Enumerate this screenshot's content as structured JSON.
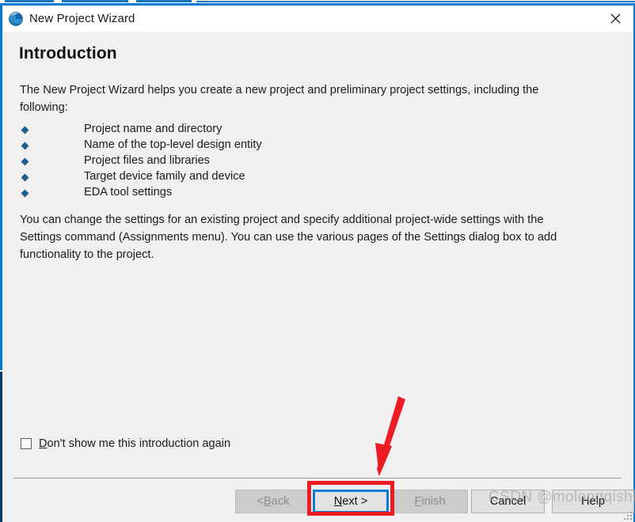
{
  "window": {
    "title": "New Project Wizard",
    "icon": "quartus-globe-icon",
    "close_label": "close-icon",
    "accent_color": "#0078d4",
    "border_lower_color": "#003a66",
    "background_color": "#f0f0f0",
    "titlebar_color": "#ffffff"
  },
  "page": {
    "heading": "Introduction",
    "intro_paragraph": "The New Project Wizard helps you create a new project and preliminary project settings, including the following:",
    "bullets": [
      {
        "label": "Project name and directory"
      },
      {
        "label": "Name of the top-level design entity"
      },
      {
        "label": "Project files and libraries"
      },
      {
        "label": "Target device family and device"
      },
      {
        "label": "EDA tool settings"
      }
    ],
    "bullet_color": "#1f5f8b",
    "closing_paragraph": "You can change the settings for an existing project and specify additional project-wide settings with the Settings command (Assignments menu). You can use the various pages of the Settings dialog box to add functionality to the project."
  },
  "checkbox": {
    "mnemonic": "D",
    "label_rest": "on't show me this introduction again",
    "checked": false
  },
  "buttons": {
    "back": {
      "pre": "< ",
      "mnemonic": "B",
      "post": "ack",
      "enabled": false,
      "focused": false
    },
    "next": {
      "pre": "",
      "mnemonic": "N",
      "post": "ext >",
      "enabled": true,
      "focused": true
    },
    "finish": {
      "pre": "",
      "mnemonic": "F",
      "post": "inish",
      "enabled": false,
      "focused": false
    },
    "cancel": {
      "pre": "",
      "mnemonic": "",
      "post": "Cancel",
      "enabled": true,
      "focused": false
    },
    "help": {
      "pre": "",
      "mnemonic": "",
      "post": "Help",
      "enabled": true,
      "focused": false
    }
  },
  "annotations": {
    "arrow_color": "#ed1c24",
    "highlight_box_color": "#ed1c24",
    "highlight_target": "next-button"
  },
  "watermark": {
    "text": "CSDN @molongqishi"
  }
}
